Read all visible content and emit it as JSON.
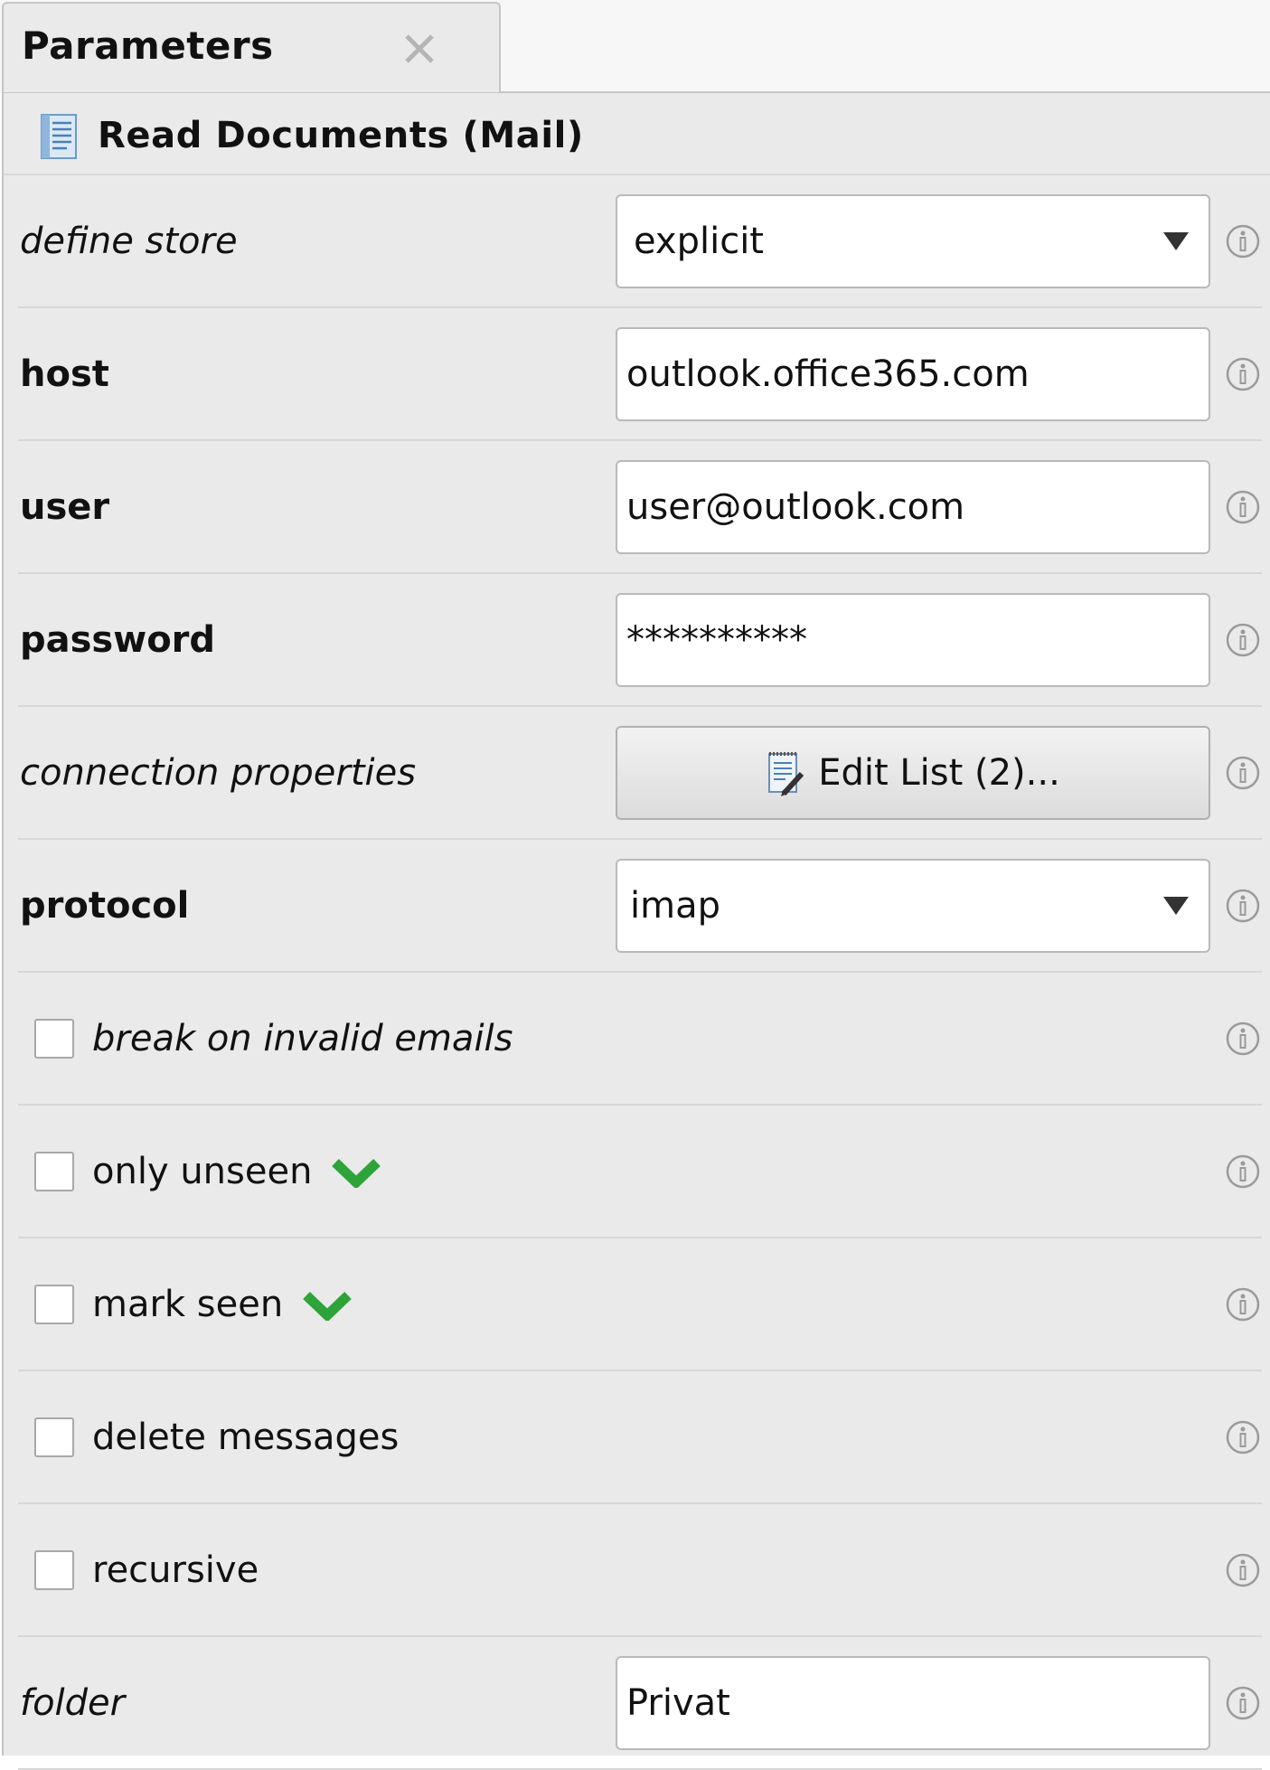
{
  "tab": {
    "title": "Parameters",
    "close_icon": "close-icon"
  },
  "operator": {
    "title": "Read Documents (Mail)",
    "icon": "document-icon"
  },
  "params": {
    "define_store": {
      "label": "define store",
      "value": "explicit"
    },
    "host": {
      "label": "host",
      "value": "outlook.office365.com"
    },
    "user": {
      "label": "user",
      "value": "user@outlook.com"
    },
    "password": {
      "label": "password",
      "value": "**********"
    },
    "connection_properties": {
      "label": "connection properties",
      "button_label": "Edit List (2)..."
    },
    "protocol": {
      "label": "protocol",
      "value": "imap"
    },
    "break_on_invalid_emails": {
      "label": "break on invalid emails",
      "checked": false
    },
    "only_unseen": {
      "label": "only unseen",
      "checked": false
    },
    "mark_seen": {
      "label": "mark seen",
      "checked": false
    },
    "delete_messages": {
      "label": "delete messages",
      "checked": false
    },
    "recursive": {
      "label": "recursive",
      "checked": false
    },
    "folder": {
      "label": "folder",
      "value": "Privat"
    }
  },
  "colors": {
    "panel_bg": "#e9eae9",
    "check_green": "#2ea33a",
    "info_gray": "#9a9a9a"
  }
}
